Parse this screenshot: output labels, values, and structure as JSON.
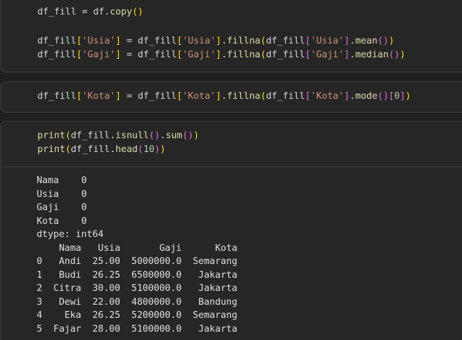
{
  "cells": [
    {
      "lines": [
        [
          {
            "t": "df_fill = df.",
            "c": "plain"
          },
          {
            "t": "copy",
            "c": "fn"
          },
          {
            "t": "()",
            "c": "b1"
          }
        ],
        [],
        [
          {
            "t": "df_fill",
            "c": "plain"
          },
          {
            "t": "[",
            "c": "b1"
          },
          {
            "t": "'Usia'",
            "c": "str"
          },
          {
            "t": "]",
            "c": "b1"
          },
          {
            "t": " = df_fill",
            "c": "plain"
          },
          {
            "t": "[",
            "c": "b1"
          },
          {
            "t": "'Usia'",
            "c": "str"
          },
          {
            "t": "]",
            "c": "b1"
          },
          {
            "t": ".",
            "c": "plain"
          },
          {
            "t": "fillna",
            "c": "fn"
          },
          {
            "t": "(",
            "c": "b1"
          },
          {
            "t": "df_fill",
            "c": "plain"
          },
          {
            "t": "[",
            "c": "b2"
          },
          {
            "t": "'Usia'",
            "c": "str"
          },
          {
            "t": "]",
            "c": "b2"
          },
          {
            "t": ".",
            "c": "plain"
          },
          {
            "t": "mean",
            "c": "fn"
          },
          {
            "t": "()",
            "c": "b2"
          },
          {
            "t": ")",
            "c": "b1"
          }
        ],
        [
          {
            "t": "df_fill",
            "c": "plain"
          },
          {
            "t": "[",
            "c": "b1"
          },
          {
            "t": "'Gaji'",
            "c": "str"
          },
          {
            "t": "]",
            "c": "b1"
          },
          {
            "t": " = df_fill",
            "c": "plain"
          },
          {
            "t": "[",
            "c": "b1"
          },
          {
            "t": "'Gaji'",
            "c": "str"
          },
          {
            "t": "]",
            "c": "b1"
          },
          {
            "t": ".",
            "c": "plain"
          },
          {
            "t": "fillna",
            "c": "fn"
          },
          {
            "t": "(",
            "c": "b1"
          },
          {
            "t": "df_fill",
            "c": "plain"
          },
          {
            "t": "[",
            "c": "b2"
          },
          {
            "t": "'Gaji'",
            "c": "str"
          },
          {
            "t": "]",
            "c": "b2"
          },
          {
            "t": ".",
            "c": "plain"
          },
          {
            "t": "median",
            "c": "fn"
          },
          {
            "t": "()",
            "c": "b2"
          },
          {
            "t": ")",
            "c": "b1"
          }
        ]
      ],
      "output": []
    },
    {
      "lines": [
        [
          {
            "t": "df_fill",
            "c": "plain"
          },
          {
            "t": "[",
            "c": "b1"
          },
          {
            "t": "'Kota'",
            "c": "str"
          },
          {
            "t": "]",
            "c": "b1"
          },
          {
            "t": " = df_fill",
            "c": "plain"
          },
          {
            "t": "[",
            "c": "b1"
          },
          {
            "t": "'Kota'",
            "c": "str"
          },
          {
            "t": "]",
            "c": "b1"
          },
          {
            "t": ".",
            "c": "plain"
          },
          {
            "t": "fillna",
            "c": "fn"
          },
          {
            "t": "(",
            "c": "b1"
          },
          {
            "t": "df_fill",
            "c": "plain"
          },
          {
            "t": "[",
            "c": "b2"
          },
          {
            "t": "'Kota'",
            "c": "str"
          },
          {
            "t": "]",
            "c": "b2"
          },
          {
            "t": ".",
            "c": "plain"
          },
          {
            "t": "mode",
            "c": "fn"
          },
          {
            "t": "()",
            "c": "b2"
          },
          {
            "t": "[",
            "c": "b2"
          },
          {
            "t": "0",
            "c": "num"
          },
          {
            "t": "]",
            "c": "b2"
          },
          {
            "t": ")",
            "c": "b1"
          }
        ]
      ],
      "output": []
    },
    {
      "lines": [
        [
          {
            "t": "print",
            "c": "fn"
          },
          {
            "t": "(",
            "c": "b1"
          },
          {
            "t": "df_fill.",
            "c": "plain"
          },
          {
            "t": "isnull",
            "c": "fn"
          },
          {
            "t": "()",
            "c": "b2"
          },
          {
            "t": ".",
            "c": "plain"
          },
          {
            "t": "sum",
            "c": "fn"
          },
          {
            "t": "()",
            "c": "b2"
          },
          {
            "t": ")",
            "c": "b1"
          }
        ],
        [
          {
            "t": "print",
            "c": "fn"
          },
          {
            "t": "(",
            "c": "b1"
          },
          {
            "t": "df_fill.",
            "c": "plain"
          },
          {
            "t": "head",
            "c": "fn"
          },
          {
            "t": "(",
            "c": "b2"
          },
          {
            "t": "10",
            "c": "num"
          },
          {
            "t": ")",
            "c": "b2"
          },
          {
            "t": ")",
            "c": "b1"
          }
        ]
      ],
      "output": [
        "Nama    0",
        "Usia    0",
        "Gaji    0",
        "Kota    0",
        "dtype: int64",
        "    Nama   Usia       Gaji      Kota",
        "0   Andi  25.00  5000000.0  Semarang",
        "1   Budi  26.25  6500000.0   Jakarta",
        "2  Citra  30.00  5100000.0   Jakarta",
        "3   Dewi  22.00  4800000.0   Bandung",
        "4    Eka  26.25  5200000.0  Semarang",
        "5  Fajar  28.00  5100000.0   Jakarta"
      ]
    }
  ],
  "colors": {
    "background": "#1f1f1f",
    "cell_background": "#262626",
    "plain": "#d4d4d4",
    "string": "#ce9178",
    "function": "#dcdcaa",
    "number": "#b5cea8",
    "bracket_level_1": "#ffd700",
    "bracket_level_2": "#da70d6",
    "output_text": "#e0e0e0"
  }
}
